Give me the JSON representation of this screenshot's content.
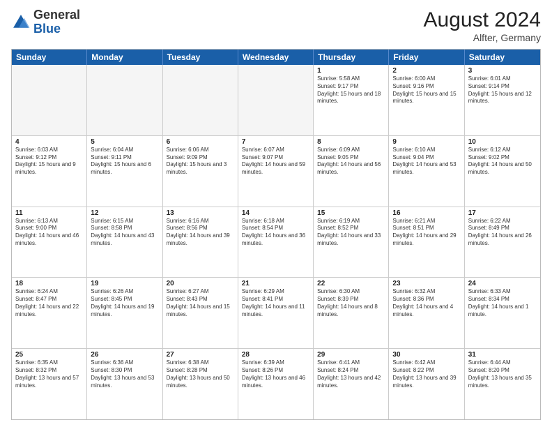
{
  "logo": {
    "general": "General",
    "blue": "Blue"
  },
  "header": {
    "month_year": "August 2024",
    "location": "Alfter, Germany"
  },
  "days_of_week": [
    "Sunday",
    "Monday",
    "Tuesday",
    "Wednesday",
    "Thursday",
    "Friday",
    "Saturday"
  ],
  "weeks": [
    [
      {
        "day": "",
        "empty": true
      },
      {
        "day": "",
        "empty": true
      },
      {
        "day": "",
        "empty": true
      },
      {
        "day": "",
        "empty": true
      },
      {
        "day": "1",
        "sunrise": "5:58 AM",
        "sunset": "9:17 PM",
        "daylight": "15 hours and 18 minutes."
      },
      {
        "day": "2",
        "sunrise": "6:00 AM",
        "sunset": "9:16 PM",
        "daylight": "15 hours and 15 minutes."
      },
      {
        "day": "3",
        "sunrise": "6:01 AM",
        "sunset": "9:14 PM",
        "daylight": "15 hours and 12 minutes."
      }
    ],
    [
      {
        "day": "4",
        "sunrise": "6:03 AM",
        "sunset": "9:12 PM",
        "daylight": "15 hours and 9 minutes."
      },
      {
        "day": "5",
        "sunrise": "6:04 AM",
        "sunset": "9:11 PM",
        "daylight": "15 hours and 6 minutes."
      },
      {
        "day": "6",
        "sunrise": "6:06 AM",
        "sunset": "9:09 PM",
        "daylight": "15 hours and 3 minutes."
      },
      {
        "day": "7",
        "sunrise": "6:07 AM",
        "sunset": "9:07 PM",
        "daylight": "14 hours and 59 minutes."
      },
      {
        "day": "8",
        "sunrise": "6:09 AM",
        "sunset": "9:05 PM",
        "daylight": "14 hours and 56 minutes."
      },
      {
        "day": "9",
        "sunrise": "6:10 AM",
        "sunset": "9:04 PM",
        "daylight": "14 hours and 53 minutes."
      },
      {
        "day": "10",
        "sunrise": "6:12 AM",
        "sunset": "9:02 PM",
        "daylight": "14 hours and 50 minutes."
      }
    ],
    [
      {
        "day": "11",
        "sunrise": "6:13 AM",
        "sunset": "9:00 PM",
        "daylight": "14 hours and 46 minutes."
      },
      {
        "day": "12",
        "sunrise": "6:15 AM",
        "sunset": "8:58 PM",
        "daylight": "14 hours and 43 minutes."
      },
      {
        "day": "13",
        "sunrise": "6:16 AM",
        "sunset": "8:56 PM",
        "daylight": "14 hours and 39 minutes."
      },
      {
        "day": "14",
        "sunrise": "6:18 AM",
        "sunset": "8:54 PM",
        "daylight": "14 hours and 36 minutes."
      },
      {
        "day": "15",
        "sunrise": "6:19 AM",
        "sunset": "8:52 PM",
        "daylight": "14 hours and 33 minutes."
      },
      {
        "day": "16",
        "sunrise": "6:21 AM",
        "sunset": "8:51 PM",
        "daylight": "14 hours and 29 minutes."
      },
      {
        "day": "17",
        "sunrise": "6:22 AM",
        "sunset": "8:49 PM",
        "daylight": "14 hours and 26 minutes."
      }
    ],
    [
      {
        "day": "18",
        "sunrise": "6:24 AM",
        "sunset": "8:47 PM",
        "daylight": "14 hours and 22 minutes."
      },
      {
        "day": "19",
        "sunrise": "6:26 AM",
        "sunset": "8:45 PM",
        "daylight": "14 hours and 19 minutes."
      },
      {
        "day": "20",
        "sunrise": "6:27 AM",
        "sunset": "8:43 PM",
        "daylight": "14 hours and 15 minutes."
      },
      {
        "day": "21",
        "sunrise": "6:29 AM",
        "sunset": "8:41 PM",
        "daylight": "14 hours and 11 minutes."
      },
      {
        "day": "22",
        "sunrise": "6:30 AM",
        "sunset": "8:39 PM",
        "daylight": "14 hours and 8 minutes."
      },
      {
        "day": "23",
        "sunrise": "6:32 AM",
        "sunset": "8:36 PM",
        "daylight": "14 hours and 4 minutes."
      },
      {
        "day": "24",
        "sunrise": "6:33 AM",
        "sunset": "8:34 PM",
        "daylight": "14 hours and 1 minute."
      }
    ],
    [
      {
        "day": "25",
        "sunrise": "6:35 AM",
        "sunset": "8:32 PM",
        "daylight": "13 hours and 57 minutes."
      },
      {
        "day": "26",
        "sunrise": "6:36 AM",
        "sunset": "8:30 PM",
        "daylight": "13 hours and 53 minutes."
      },
      {
        "day": "27",
        "sunrise": "6:38 AM",
        "sunset": "8:28 PM",
        "daylight": "13 hours and 50 minutes."
      },
      {
        "day": "28",
        "sunrise": "6:39 AM",
        "sunset": "8:26 PM",
        "daylight": "13 hours and 46 minutes."
      },
      {
        "day": "29",
        "sunrise": "6:41 AM",
        "sunset": "8:24 PM",
        "daylight": "13 hours and 42 minutes."
      },
      {
        "day": "30",
        "sunrise": "6:42 AM",
        "sunset": "8:22 PM",
        "daylight": "13 hours and 39 minutes."
      },
      {
        "day": "31",
        "sunrise": "6:44 AM",
        "sunset": "8:20 PM",
        "daylight": "13 hours and 35 minutes."
      }
    ]
  ]
}
